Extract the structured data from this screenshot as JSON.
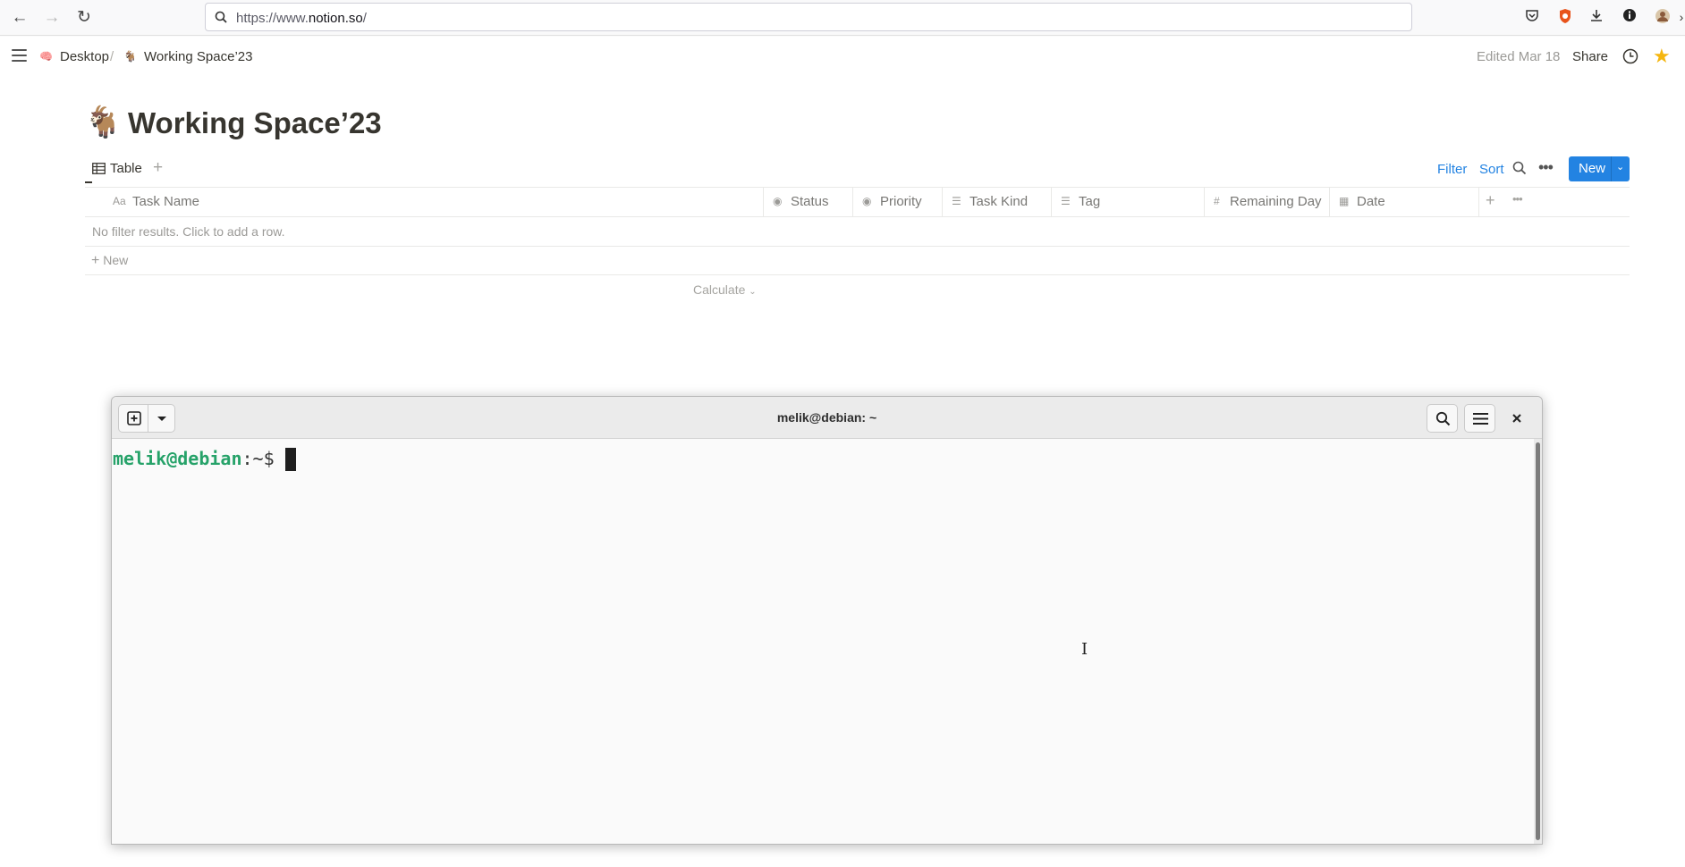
{
  "browser": {
    "url_prefix": "https://www.",
    "url_host": "notion.so",
    "url_suffix": "/"
  },
  "notion": {
    "breadcrumb": [
      {
        "icon": "🧠",
        "label": "Desktop"
      },
      {
        "icon": "🐐",
        "label": "Working Space’23"
      }
    ],
    "breadcrumb_sep": "/",
    "edited": "Edited Mar 18",
    "share": "Share",
    "page": {
      "emoji": "🐐",
      "title": "Working Space’23"
    },
    "view_tab": "Table",
    "toolbar": {
      "filter": "Filter",
      "sort": "Sort",
      "new": "New"
    },
    "columns": [
      {
        "icon": "Aa",
        "label": "Task Name"
      },
      {
        "icon": "◉",
        "label": "Status"
      },
      {
        "icon": "◉",
        "label": "Priority"
      },
      {
        "icon": "☰",
        "label": "Task Kind"
      },
      {
        "icon": "☰",
        "label": "Tag"
      },
      {
        "icon": "#",
        "label": "Remaining Day"
      },
      {
        "icon": "▦",
        "label": "Date"
      }
    ],
    "empty_message": "No filter results. Click to add a row.",
    "add_row": "New",
    "calculate": "Calculate"
  },
  "terminal": {
    "title": "melik@debian: ~",
    "prompt_user": "melik@debian",
    "prompt_path": ":~$"
  }
}
